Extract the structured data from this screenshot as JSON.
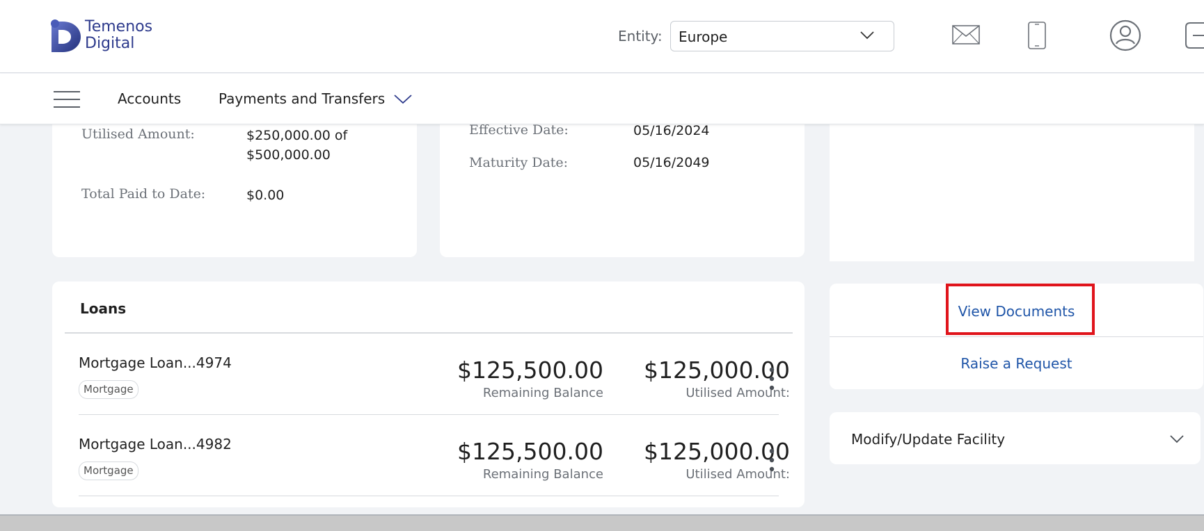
{
  "header": {
    "logo_line1": "Temenos",
    "logo_line2": "Digital",
    "entity_label": "Entity:",
    "entity_value": "Europe",
    "icons": [
      "mail-icon",
      "phone-icon",
      "profile-icon",
      "logout-icon"
    ]
  },
  "nav": {
    "items": [
      {
        "label": "Accounts"
      },
      {
        "label": "Payments and Transfers"
      }
    ]
  },
  "facility_details": {
    "utilised_amount_label": "Utilised Amount:",
    "utilised_amount_value_line1": "$250,000.00 of",
    "utilised_amount_value_line2": "$500,000.00",
    "total_paid_label": "Total Paid to Date:",
    "total_paid_value": "$0.00"
  },
  "dates": {
    "effective_label": "Effective Date:",
    "effective_value": "05/16/2024",
    "maturity_label": "Maturity Date:",
    "maturity_value": "05/16/2049"
  },
  "loans": {
    "title": "Loans",
    "rows": [
      {
        "name": "Mortgage Loan...4974",
        "tag": "Mortgage",
        "remaining_balance": "$125,500.00",
        "remaining_label": "Remaining Balance",
        "utilised_amount": "$125,000.00",
        "utilised_label": "Utilised Amount:"
      },
      {
        "name": "Mortgage Loan...4982",
        "tag": "Mortgage",
        "remaining_balance": "$125,500.00",
        "remaining_label": "Remaining Balance",
        "utilised_amount": "$125,000.00",
        "utilised_label": "Utilised Amount:"
      }
    ]
  },
  "actions": {
    "view_documents": "View Documents",
    "raise_request": "Raise a Request"
  },
  "modify": {
    "label": "Modify/Update Facility"
  },
  "colors": {
    "brand": "#2d3a8c",
    "link": "#1f55a8",
    "highlight": "#e0141b",
    "background": "#f1f3f6"
  }
}
